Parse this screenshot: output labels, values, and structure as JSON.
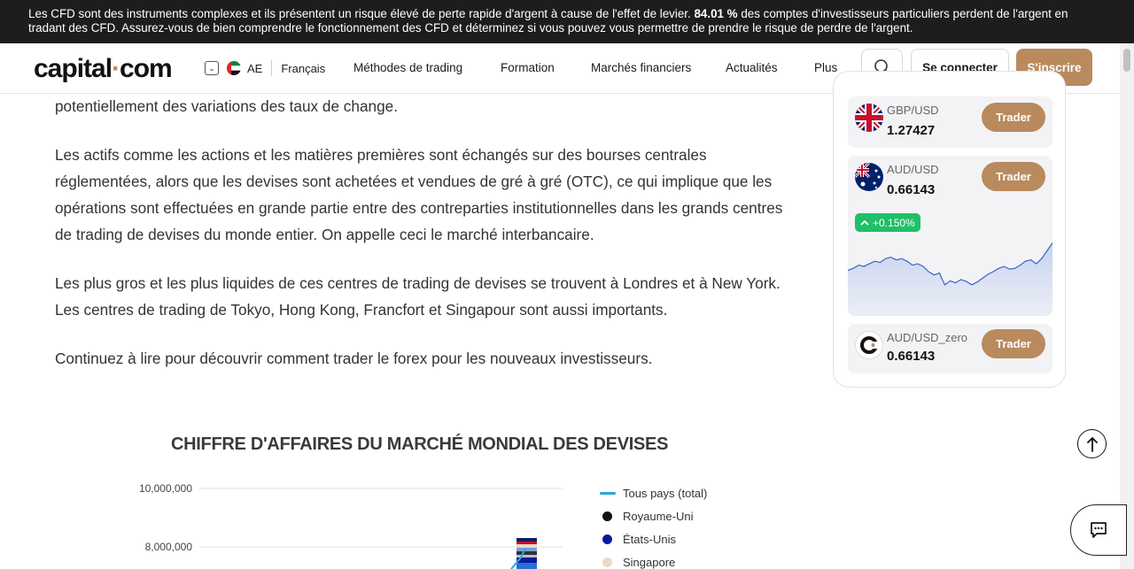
{
  "risk_banner": {
    "text_before": "Les CFD sont des instruments complexes et ils présentent un risque élevé de perte rapide d'argent à cause de l'effet de levier. ",
    "percent": "84.01 %",
    "text_after": " des comptes d'investisseurs particuliers perdent de l'argent en tradant des CFD. Assurez-vous de bien comprendre le fonctionnement des CFD et déterminez si vous pouvez vous permettre de prendre le risque de perdre de l'argent."
  },
  "header": {
    "logo_left": "capital",
    "logo_dot": "·",
    "logo_right": "com",
    "region_code": "AE",
    "language": "Français",
    "nav": [
      "Méthodes de trading",
      "Formation",
      "Marchés financiers",
      "Actualités",
      "Plus"
    ],
    "login": "Se connecter",
    "signup": "S'inscrire"
  },
  "article": {
    "p0": "potentiellement des variations des taux de change.",
    "p1": "Les actifs comme les actions et les matières premières sont échangés sur des bourses centrales réglementées, alors que les devises sont achetées et vendues de gré à gré (OTC), ce qui implique que les opérations sont effectuées en grande partie entre des contreparties institutionnelles dans les grands centres de trading de devises du monde entier. On appelle ceci le marché interbancaire.",
    "p2": "Les plus gros et les plus liquides de ces centres de trading de devises se trouvent à Londres et à New York. Les centres de trading de Tokyo, Hong Kong, Francfort et Singapour sont aussi importants.",
    "p3": "Continuez à lire pour découvrir comment trader le forex pour les nouveaux investisseurs."
  },
  "widget": {
    "trade_label": "Trader",
    "cards": [
      {
        "name": "GBP/USD",
        "price": "1.27427"
      },
      {
        "name": "AUD/USD",
        "price": "0.66143",
        "change": "+0.150%"
      },
      {
        "name": "AUD/USD_zero",
        "price": "0.66143"
      }
    ],
    "spark_values": [
      0.52,
      0.55,
      0.6,
      0.58,
      0.62,
      0.66,
      0.64,
      0.7,
      0.72,
      0.68,
      0.7,
      0.66,
      0.6,
      0.62,
      0.58,
      0.5,
      0.45,
      0.48,
      0.3,
      0.36,
      0.33,
      0.38,
      0.35,
      0.3,
      0.34,
      0.4,
      0.46,
      0.5,
      0.55,
      0.58,
      0.54,
      0.55,
      0.6,
      0.66,
      0.68,
      0.62,
      0.7,
      0.82,
      0.94
    ],
    "colors": {
      "accent": "#b98a5e",
      "up": "#1fbf68",
      "spark_line": "#3b64c8"
    }
  },
  "chart_data": {
    "type": "line",
    "title": "CHIFFRE D'AFFAIRES DU MARCHÉ MONDIAL DES DEVISES",
    "y_ticks": [
      "10,000,000",
      "8,000,000"
    ],
    "y_tick_values": [
      10000000,
      8000000
    ],
    "legend": [
      {
        "label": "Tous pays (total)",
        "color": "#29a8e0",
        "kind": "line"
      },
      {
        "label": "Royaume-Uni",
        "color": "#111111",
        "kind": "dot"
      },
      {
        "label": "États-Unis",
        "color": "#0a1a9c",
        "kind": "dot"
      },
      {
        "label": "Singapore",
        "color": "#e8d9c8",
        "kind": "dot"
      }
    ]
  }
}
